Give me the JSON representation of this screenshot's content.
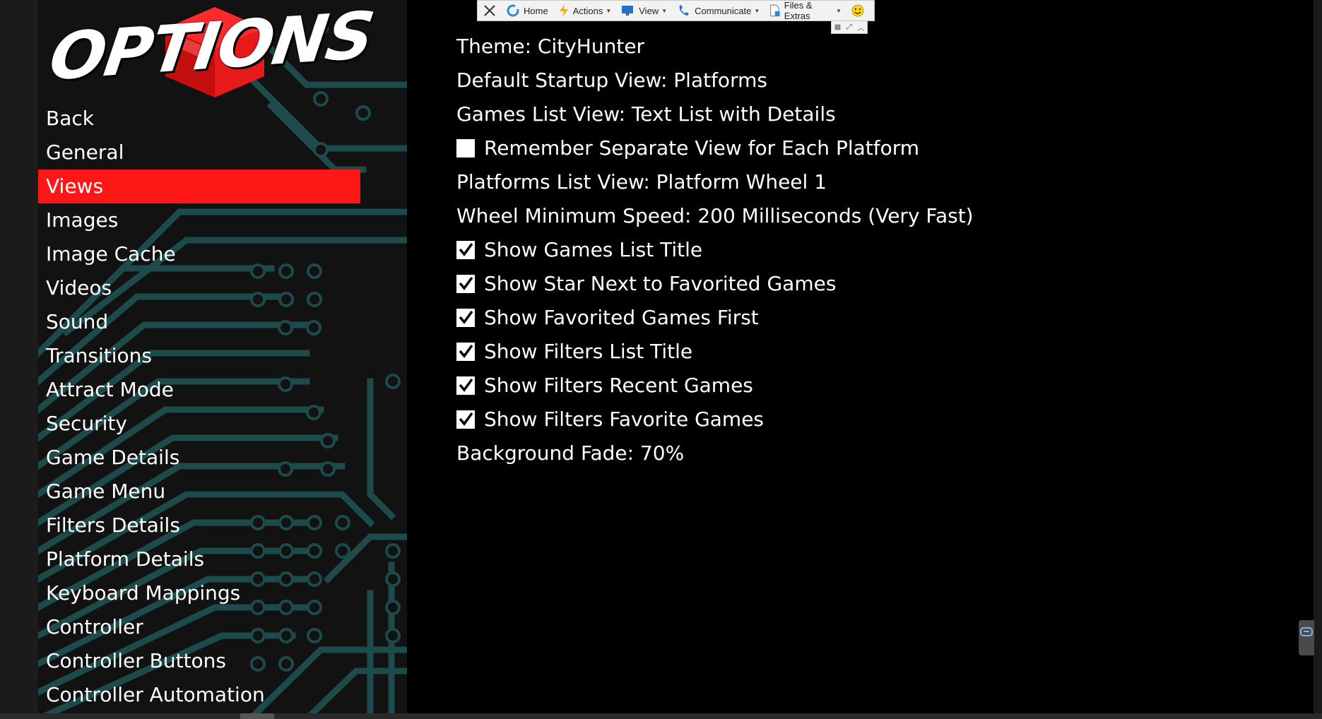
{
  "logo": {
    "text": "OPTIONS"
  },
  "sidebar": {
    "items": [
      {
        "label": "Back",
        "active": false
      },
      {
        "label": "General",
        "active": false
      },
      {
        "label": "Views",
        "active": true
      },
      {
        "label": "Images",
        "active": false
      },
      {
        "label": "Image Cache",
        "active": false
      },
      {
        "label": "Videos",
        "active": false
      },
      {
        "label": "Sound",
        "active": false
      },
      {
        "label": "Transitions",
        "active": false
      },
      {
        "label": "Attract Mode",
        "active": false
      },
      {
        "label": "Security",
        "active": false
      },
      {
        "label": "Game Details",
        "active": false
      },
      {
        "label": "Game Menu",
        "active": false
      },
      {
        "label": "Filters Details",
        "active": false
      },
      {
        "label": "Platform Details",
        "active": false
      },
      {
        "label": "Keyboard Mappings",
        "active": false
      },
      {
        "label": "Controller",
        "active": false
      },
      {
        "label": "Controller Buttons",
        "active": false
      },
      {
        "label": "Controller Automation",
        "active": false
      }
    ]
  },
  "settings": {
    "theme": "Theme: CityHunter",
    "default_startup_view": "Default Startup View: Platforms",
    "games_list_view": "Games List View: Text List with Details",
    "remember_separate_view": {
      "label": "Remember Separate View for Each Platform",
      "checked": false
    },
    "platforms_list_view": "Platforms List View: Platform Wheel 1",
    "wheel_minimum_speed": "Wheel Minimum Speed: 200 Milliseconds (Very Fast)",
    "show_games_list_title": {
      "label": "Show Games List Title",
      "checked": true
    },
    "show_star_favorited": {
      "label": "Show Star Next to Favorited Games",
      "checked": true
    },
    "show_favorited_first": {
      "label": "Show Favorited Games First",
      "checked": true
    },
    "show_filters_list_title": {
      "label": "Show Filters List Title",
      "checked": true
    },
    "show_filters_recent": {
      "label": "Show Filters Recent Games",
      "checked": true
    },
    "show_filters_favorite": {
      "label": "Show Filters Favorite Games",
      "checked": true
    },
    "background_fade": "Background Fade: 70%"
  },
  "remote_toolbar": {
    "close_icon": "close-icon",
    "home": "Home",
    "actions": "Actions",
    "view": "View",
    "communicate": "Communicate",
    "files_extras": "Files & Extras"
  },
  "colors": {
    "accent": "#ff1616",
    "circuit": "#1d4a4a",
    "background": "#000000"
  }
}
